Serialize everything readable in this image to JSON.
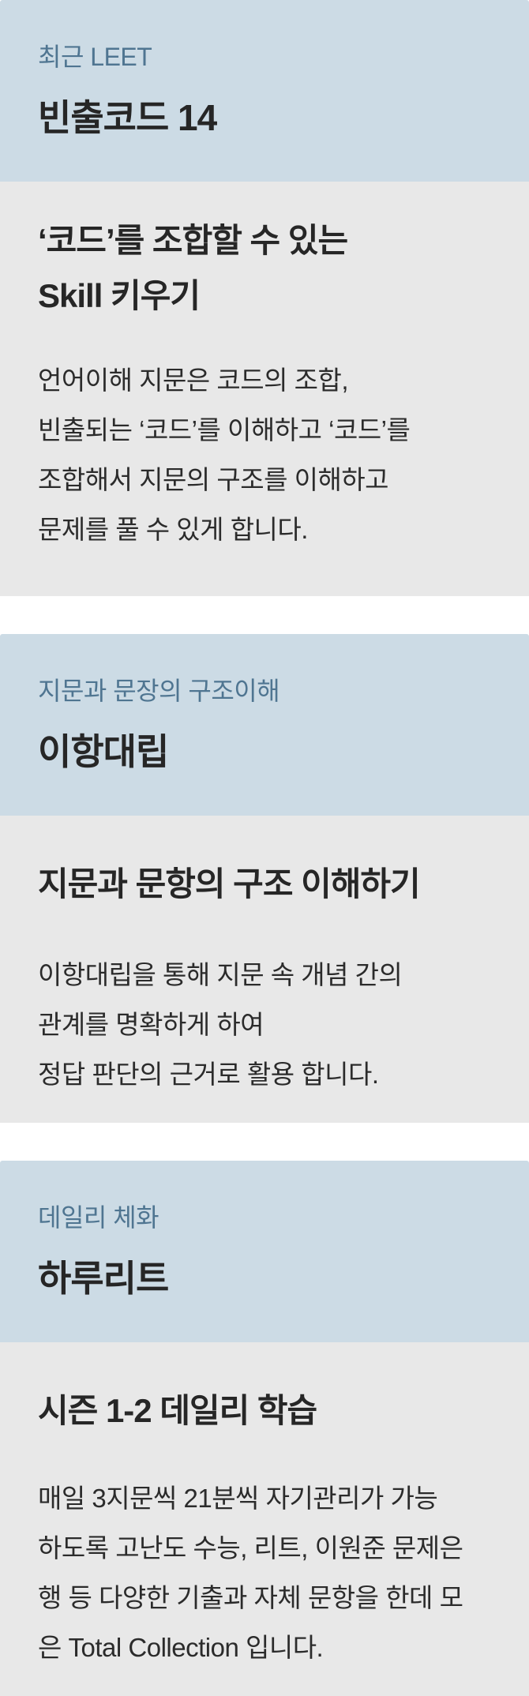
{
  "cards": [
    {
      "eyebrow": "최근 LEET",
      "title": "빈출코드 14",
      "headline": [
        "‘코드’를 조합할 수 있는",
        "Skill 키우기"
      ],
      "description": [
        "언어이해 지문은 코드의 조합,",
        "빈출되는 ‘코드’를 이해하고 ‘코드’를",
        "조합해서 지문의 구조를 이해하고",
        "문제를 풀 수 있게 합니다."
      ]
    },
    {
      "eyebrow": "지문과 문장의 구조이해",
      "title": "이항대립",
      "headline": [
        "지문과 문항의 구조 이해하기"
      ],
      "description": [
        "이항대립을 통해 지문 속 개념 간의",
        "관계를 명확하게 하여",
        "정답 판단의 근거로 활용 합니다."
      ]
    },
    {
      "eyebrow": "데일리 체화",
      "title": "하루리트",
      "headline": [
        "시즌 1-2 데일리 학습"
      ],
      "description": [
        "매일 3지문씩 21분씩 자기관리가 가능",
        "하도록 고난도 수능, 리트, 이원준 문제은",
        "행 등 다양한 기출과 자체 문항을 한데 모",
        "은 Total Collection 입니다."
      ]
    }
  ],
  "colors": {
    "header_bg": "#ccdbe5",
    "body_bg": "#e8e8e8",
    "eyebrow": "#4f7591",
    "title": "#262626"
  }
}
